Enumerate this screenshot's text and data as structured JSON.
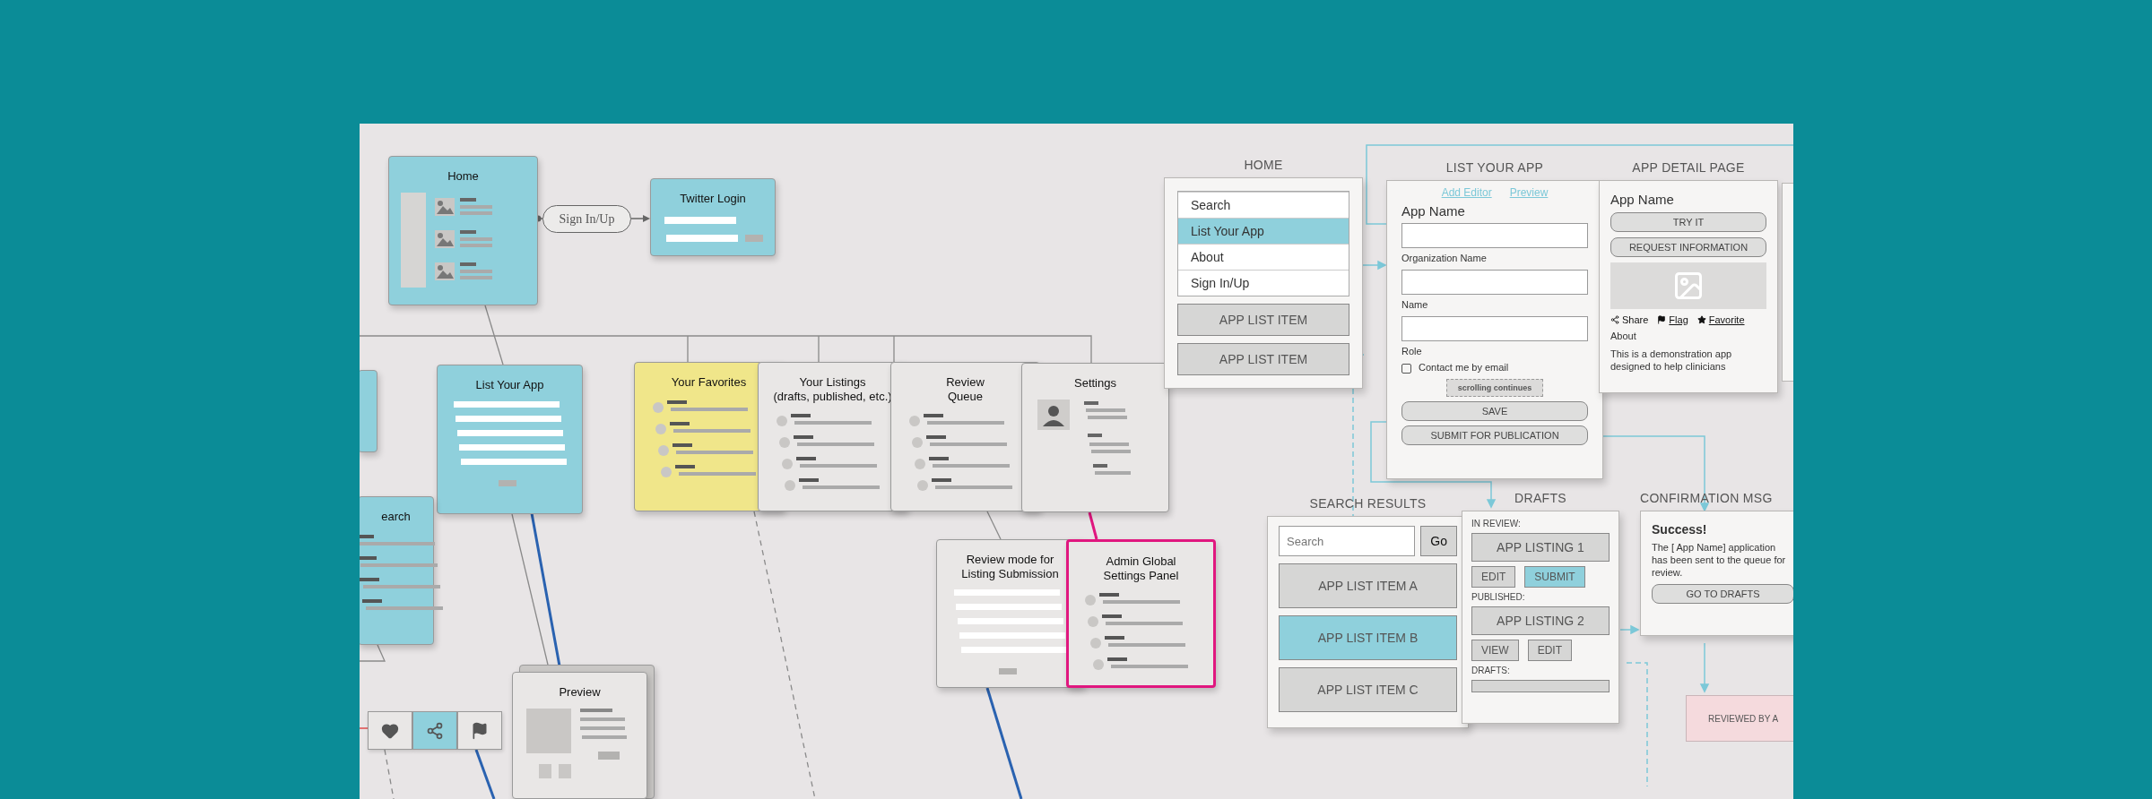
{
  "flow_map": {
    "nodes": [
      {
        "kind": "home",
        "title": "Home",
        "color": "#8fd0dc",
        "highlighted": false
      },
      {
        "kind": "login",
        "title": "Twitter Login",
        "color": "#8fd0dc",
        "highlighted": false
      },
      {
        "kind": "stub",
        "color": "#8fd0dc",
        "highlighted": false
      },
      {
        "kind": "form",
        "title": "List Your App",
        "color": "#8fd0dc",
        "highlighted": false
      },
      {
        "kind": "list",
        "title": "earch",
        "color": "#8fd0dc",
        "highlighted": false
      },
      {
        "kind": "list",
        "title": "Your Favorites",
        "color": "#f0e68a",
        "highlighted": false
      },
      {
        "kind": "list",
        "title": "Your Listings\n(drafts, published, etc.)",
        "color": "#e9e7e6",
        "highlighted": false
      },
      {
        "kind": "list",
        "title": "Review\nQueue",
        "color": "#e9e7e6",
        "highlighted": false
      },
      {
        "kind": "settings",
        "title": "Settings",
        "color": "#e9e7e6",
        "highlighted": false
      },
      {
        "kind": "form",
        "title": "Review mode for\nListing Submission",
        "color": "#e9e7e6",
        "highlighted": false
      },
      {
        "kind": "list",
        "title": "Admin Global\nSettings Panel",
        "color": "#e9e7e6",
        "highlighted": true
      },
      {
        "kind": "preview",
        "title": "Preview",
        "color": "#e9e7e6",
        "highlighted": false
      }
    ],
    "pill": {
      "label": "Sign In/Up"
    },
    "action_tiles": [
      {
        "kind": "heart",
        "color": "#e9e7e6"
      },
      {
        "kind": "share",
        "color": "#8fd0dc"
      },
      {
        "kind": "flag",
        "color": "#e9e7e6"
      }
    ]
  },
  "wireframes": {
    "home": {
      "heading": "HOME",
      "menu": [
        {
          "label": "Search",
          "selected": false
        },
        {
          "label": "List Your App",
          "selected": true
        },
        {
          "label": "About",
          "selected": false
        },
        {
          "label": "Sign In/Up",
          "selected": false
        }
      ],
      "list_items": [
        "APP LIST ITEM",
        "APP LIST ITEM"
      ]
    },
    "list_your_app": {
      "heading": "LIST YOUR APP",
      "links": [
        "Add Editor",
        "Preview"
      ],
      "title": "App Name",
      "fields": [
        {
          "label": "Organization Name"
        },
        {
          "label": "Name"
        },
        {
          "label": "Role"
        }
      ],
      "checkbox": {
        "label": "Contact me by email",
        "checked": false
      },
      "note": "scrolling continues",
      "buttons": [
        "SAVE",
        "SUBMIT FOR PUBLICATION"
      ]
    },
    "app_detail": {
      "heading": "APP DETAIL PAGE",
      "title": "App Name",
      "buttons": [
        "TRY IT",
        "REQUEST INFORMATION"
      ],
      "actions": [
        {
          "kind": "share",
          "label": "Share"
        },
        {
          "kind": "flag",
          "label": "Flag"
        },
        {
          "kind": "favorite",
          "label": "Favorite"
        }
      ],
      "about_label": "About",
      "about_text": "This is a demonstration app designed to help clinicians"
    },
    "search_results": {
      "heading": "SEARCH RESULTS",
      "search": {
        "placeholder": "Search"
      },
      "go": "Go",
      "items": [
        {
          "label": "APP LIST ITEM A",
          "selected": false
        },
        {
          "label": "APP LIST ITEM B",
          "selected": true
        },
        {
          "label": "APP LIST ITEM C",
          "selected": false
        }
      ]
    },
    "drafts": {
      "heading": "DRAFTS",
      "sections": [
        {
          "kind": "listing",
          "label": "IN REVIEW:",
          "listing": "APP LISTING 1",
          "actions": [
            {
              "label": "EDIT",
              "selected": false
            },
            {
              "label": "SUBMIT",
              "selected": true
            }
          ]
        },
        {
          "kind": "listing",
          "label": "PUBLISHED:",
          "listing": "APP LISTING 2",
          "actions": [
            {
              "label": "VIEW",
              "selected": false
            },
            {
              "label": "EDIT",
              "selected": false
            }
          ]
        },
        {
          "kind": "blank",
          "label": "DRAFTS:"
        }
      ]
    },
    "confirmation": {
      "heading": "CONFIRMATION MSG",
      "title": "Success!",
      "message": "The [ App Name] application has been sent to the queue for review.",
      "button": "GO TO DRAFTS"
    },
    "review_badge": {
      "label": "REVIEWED BY A"
    }
  }
}
